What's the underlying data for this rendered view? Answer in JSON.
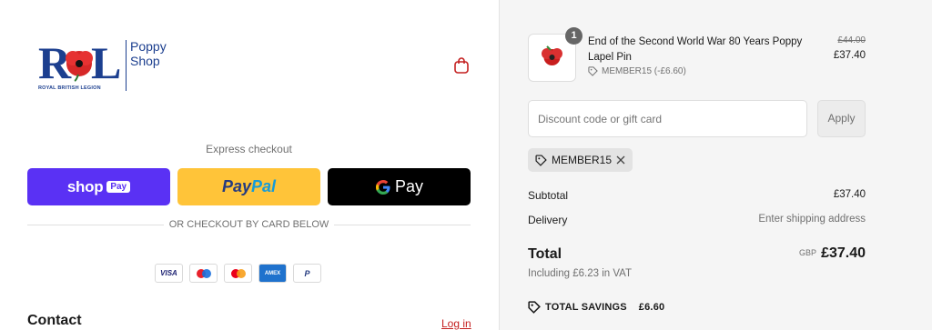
{
  "logo": {
    "letters": "RBL",
    "shop_line1": "Poppy",
    "shop_line2": "Shop",
    "subtitle": "ROYAL BRITISH LEGION"
  },
  "express": {
    "heading": "Express checkout",
    "shop_pay": {
      "main": "shop",
      "badge": "Pay"
    },
    "paypal": {
      "part1": "Pay",
      "part2": "Pal"
    },
    "google_pay": {
      "label": "Pay"
    }
  },
  "divider_text": "OR CHECKOUT BY CARD BELOW",
  "card_brands": [
    "VISA",
    "maestro",
    "mastercard",
    "AMEX",
    "P"
  ],
  "contact": {
    "heading": "Contact",
    "login_link": "Log in"
  },
  "order": {
    "item": {
      "quantity": "1",
      "name": "End of the Second World War 80 Years Poppy Lapel Pin",
      "discount": "MEMBER15 (-£6.60)",
      "original_price": "£44.00",
      "price": "£37.40"
    },
    "discount_placeholder": "Discount code or gift card",
    "apply_label": "Apply",
    "applied_code": "MEMBER15",
    "subtotal_label": "Subtotal",
    "subtotal_value": "£37.40",
    "delivery_label": "Delivery",
    "delivery_value": "Enter shipping address",
    "total_label": "Total",
    "total_currency": "GBP",
    "total_value": "£37.40",
    "vat_note": "Including £6.23 in VAT",
    "savings_label": "TOTAL SAVINGS",
    "savings_value": "£6.60"
  },
  "colors": {
    "brand_blue": "#1c3f8f",
    "poppy_red": "#d62828",
    "shop_pay": "#5a31f4",
    "paypal_yellow": "#ffc439",
    "link_red": "#c42020"
  }
}
